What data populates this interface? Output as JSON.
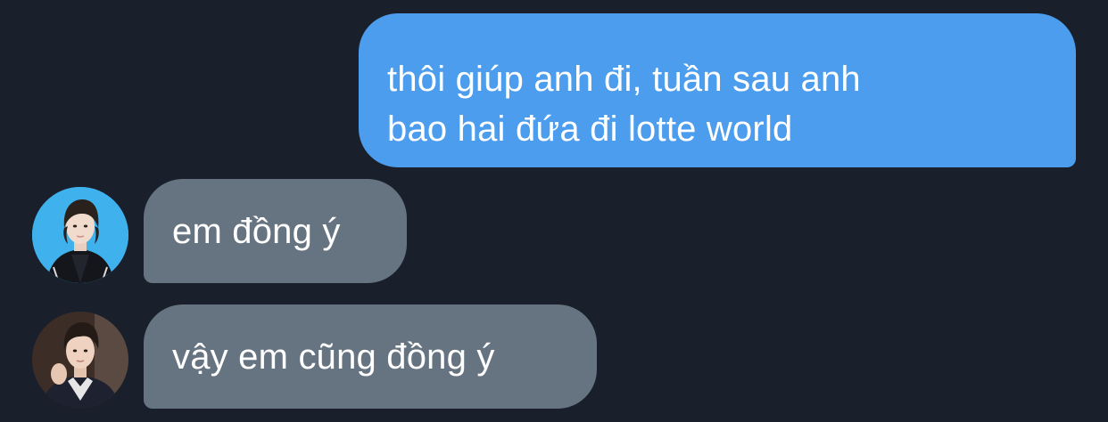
{
  "conversation": {
    "messages": [
      {
        "direction": "outgoing",
        "lines": [
          "thôi giúp anh đi, tuần sau anh",
          "bao hai đứa đi lotte world"
        ]
      },
      {
        "direction": "incoming",
        "avatar_icon": "person-avatar-icon",
        "text": "em đồng ý"
      },
      {
        "direction": "incoming",
        "avatar_icon": "person-avatar-icon",
        "text": "vậy em cũng đồng ý"
      }
    ]
  },
  "colors": {
    "background": "#19202b",
    "outgoing_bubble": "#4c9ded",
    "incoming_bubble": "#667482",
    "text": "#ffffff"
  }
}
